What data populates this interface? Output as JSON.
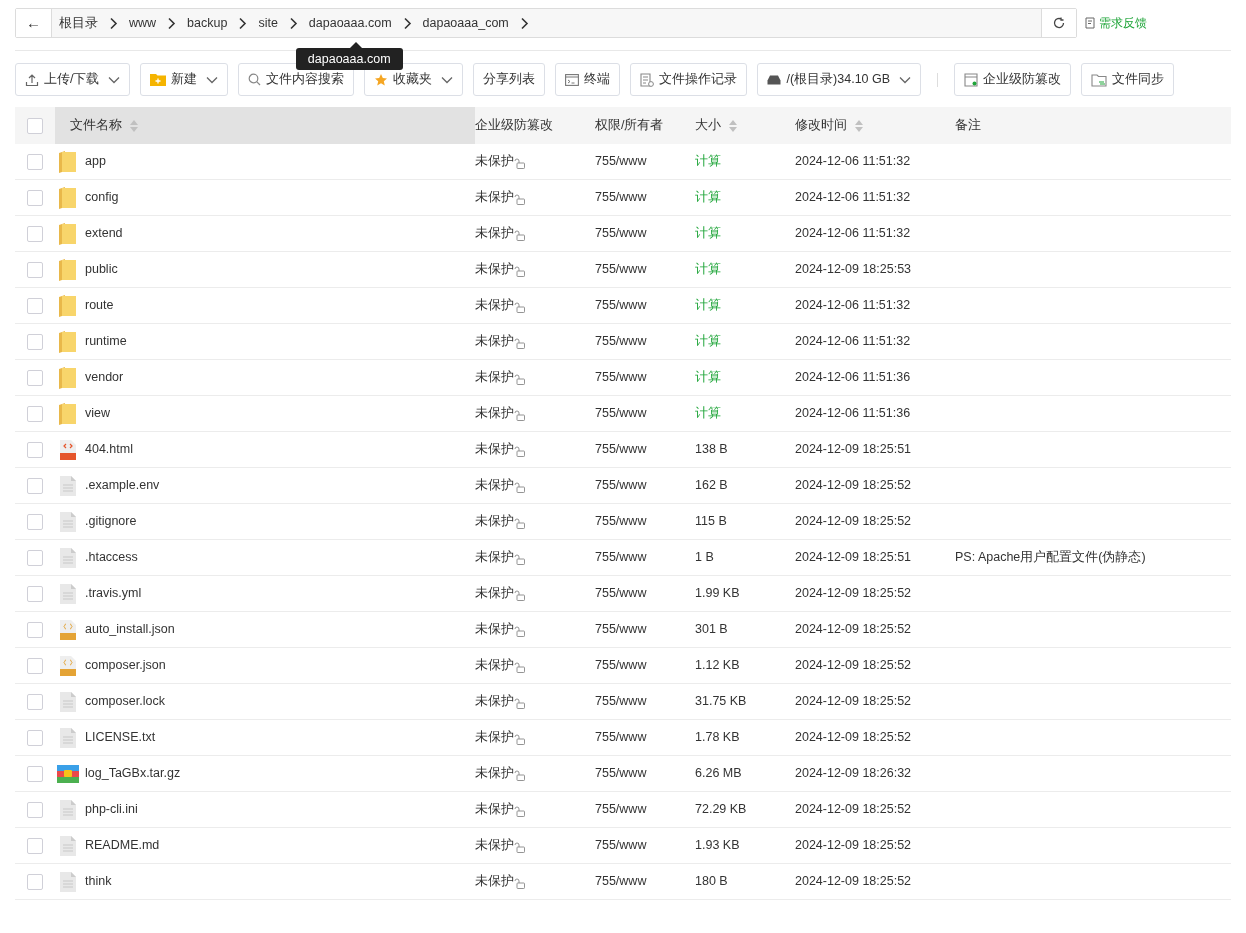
{
  "breadcrumb": {
    "back": "←",
    "items": [
      "根目录",
      "www",
      "backup",
      "site",
      "dapaoaaa.com",
      "dapaoaaa_com"
    ],
    "tooltip": "dapaoaaa.com"
  },
  "feedback": "需求反馈",
  "toolbar": [
    {
      "label": "上传/下载",
      "dropdown": true
    },
    {
      "label": "新建",
      "dropdown": true
    },
    {
      "label": "文件内容搜索",
      "dropdown": false
    },
    {
      "label": "收藏夹",
      "dropdown": true
    },
    {
      "label": "分享列表",
      "dropdown": false
    },
    {
      "label": "终端",
      "dropdown": false
    },
    {
      "label": "文件操作记录",
      "dropdown": false
    },
    {
      "label": "/(根目录)34.10 GB",
      "dropdown": true
    },
    {
      "label": "企业级防篡改",
      "dropdown": false
    },
    {
      "label": "文件同步",
      "dropdown": false
    }
  ],
  "table": {
    "all_checked": false,
    "columns": [
      {
        "label": "文件名称",
        "sortable": true,
        "sorted": true
      },
      {
        "label": "企业级防篡改",
        "sortable": false,
        "sorted": false
      },
      {
        "label": "权限/所有者",
        "sortable": false,
        "sorted": false
      },
      {
        "label": "大小",
        "sortable": true,
        "sorted": false
      },
      {
        "label": "修改时间",
        "sortable": true,
        "sorted": false
      },
      {
        "label": "备注",
        "sortable": false,
        "sorted": false
      }
    ],
    "rows": [
      {
        "kind": "folder",
        "name": "app",
        "protect": "未保护",
        "perm": "755/www",
        "size": "计算",
        "time": "2024-12-06 11:51:32",
        "checked": false
      },
      {
        "kind": "folder",
        "name": "config",
        "protect": "未保护",
        "perm": "755/www",
        "size": "计算",
        "time": "2024-12-06 11:51:32",
        "checked": false
      },
      {
        "kind": "folder",
        "name": "extend",
        "protect": "未保护",
        "perm": "755/www",
        "size": "计算",
        "time": "2024-12-06 11:51:32",
        "checked": false
      },
      {
        "kind": "folder",
        "name": "public",
        "protect": "未保护",
        "perm": "755/www",
        "size": "计算",
        "time": "2024-12-09 18:25:53",
        "checked": false
      },
      {
        "kind": "folder",
        "name": "route",
        "protect": "未保护",
        "perm": "755/www",
        "size": "计算",
        "time": "2024-12-06 11:51:32",
        "checked": false
      },
      {
        "kind": "folder",
        "name": "runtime",
        "protect": "未保护",
        "perm": "755/www",
        "size": "计算",
        "time": "2024-12-06 11:51:32",
        "checked": false
      },
      {
        "kind": "folder",
        "name": "vendor",
        "protect": "未保护",
        "perm": "755/www",
        "size": "计算",
        "time": "2024-12-06 11:51:36",
        "checked": false
      },
      {
        "kind": "folder",
        "name": "view",
        "protect": "未保护",
        "perm": "755/www",
        "size": "计算",
        "time": "2024-12-06 11:51:36",
        "checked": false
      },
      {
        "kind": "html",
        "name": "404.html",
        "protect": "未保护",
        "perm": "755/www",
        "size": "138 B",
        "time": "2024-12-09 18:25:51",
        "checked": false
      },
      {
        "kind": "text",
        "name": ".example.env",
        "protect": "未保护",
        "perm": "755/www",
        "size": "162 B",
        "time": "2024-12-09 18:25:52",
        "checked": false
      },
      {
        "kind": "text",
        "name": ".gitignore",
        "protect": "未保护",
        "perm": "755/www",
        "size": "115 B",
        "time": "2024-12-09 18:25:52",
        "checked": false
      },
      {
        "kind": "text",
        "name": ".htaccess",
        "protect": "未保护",
        "perm": "755/www",
        "size": "1 B",
        "time": "2024-12-09 18:25:51",
        "note": "PS: Apache用户配置文件(伪静态)",
        "checked": false
      },
      {
        "kind": "text",
        "name": ".travis.yml",
        "protect": "未保护",
        "perm": "755/www",
        "size": "1.99 KB",
        "time": "2024-12-09 18:25:52",
        "checked": false
      },
      {
        "kind": "json",
        "name": "auto_install.json",
        "protect": "未保护",
        "perm": "755/www",
        "size": "301 B",
        "time": "2024-12-09 18:25:52",
        "checked": false
      },
      {
        "kind": "json",
        "name": "composer.json",
        "protect": "未保护",
        "perm": "755/www",
        "size": "1.12 KB",
        "time": "2024-12-09 18:25:52",
        "checked": false
      },
      {
        "kind": "text",
        "name": "composer.lock",
        "protect": "未保护",
        "perm": "755/www",
        "size": "31.75 KB",
        "time": "2024-12-09 18:25:52",
        "checked": false
      },
      {
        "kind": "text",
        "name": "LICENSE.txt",
        "protect": "未保护",
        "perm": "755/www",
        "size": "1.78 KB",
        "time": "2024-12-09 18:25:52",
        "checked": false
      },
      {
        "kind": "archive",
        "name": "log_TaGBx.tar.gz",
        "protect": "未保护",
        "perm": "755/www",
        "size": "6.26 MB",
        "time": "2024-12-09 18:26:32",
        "checked": false
      },
      {
        "kind": "text",
        "name": "php-cli.ini",
        "protect": "未保护",
        "perm": "755/www",
        "size": "72.29 KB",
        "time": "2024-12-09 18:25:52",
        "checked": false
      },
      {
        "kind": "text",
        "name": "README.md",
        "protect": "未保护",
        "perm": "755/www",
        "size": "1.93 KB",
        "time": "2024-12-09 18:25:52",
        "checked": false
      },
      {
        "kind": "text",
        "name": "think",
        "protect": "未保护",
        "perm": "755/www",
        "size": "180 B",
        "time": "2024-12-09 18:25:52",
        "checked": false
      }
    ]
  }
}
